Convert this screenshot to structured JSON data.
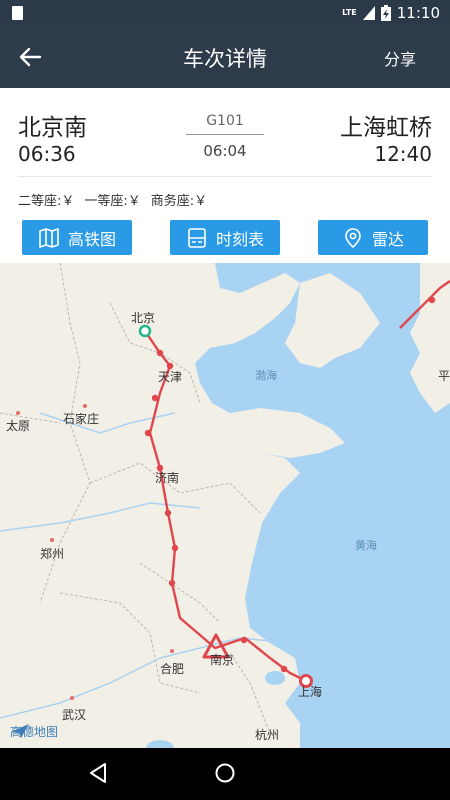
{
  "status_bar": {
    "network": "LTE",
    "time": "11:10"
  },
  "app_bar": {
    "title": "车次详情",
    "share_label": "分享",
    "back_icon": "arrow-left-icon"
  },
  "trip": {
    "from_station": "北京南",
    "from_time": "06:36",
    "train_number": "G101",
    "duration": "06:04",
    "to_station": "上海虹桥",
    "to_time": "12:40"
  },
  "seats": [
    {
      "label": "二等座:￥"
    },
    {
      "label": "一等座:￥"
    },
    {
      "label": "商务座:￥"
    }
  ],
  "actions": {
    "rail_map": {
      "label": "高铁图",
      "icon": "map-icon"
    },
    "timetable": {
      "label": "时刻表",
      "icon": "timetable-icon"
    },
    "radar": {
      "label": "雷达",
      "icon": "location-pin-icon"
    }
  },
  "map": {
    "cities": {
      "beijing": "北京",
      "tianjin": "天津",
      "shijiazhuang": "石家庄",
      "taiyuan": "太原",
      "jinan": "济南",
      "zhengzhou": "郑州",
      "hefei": "合肥",
      "nanjing": "南京",
      "shanghai": "上海",
      "wuhan": "武汉",
      "hangzhou": "杭州",
      "edge": "平"
    },
    "seas": {
      "bohai": "渤海",
      "yellow_sea": "黄海"
    },
    "brand": "高德地图",
    "colors": {
      "land": "#f2efe6",
      "water": "#a9d3f2",
      "route": "#e0474c"
    }
  },
  "nav_bar": {
    "back": "back-triangle-icon",
    "home": "home-circle-icon"
  }
}
